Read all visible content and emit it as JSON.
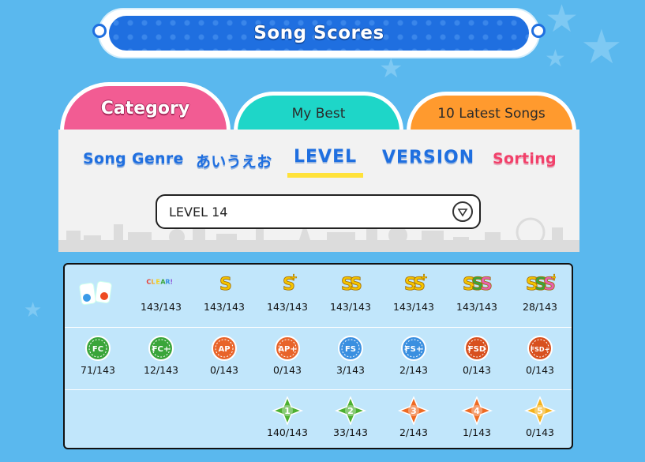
{
  "header": {
    "title": "Song Scores"
  },
  "tabs": [
    {
      "label": "Category",
      "active": true
    },
    {
      "label": "My Best",
      "active": false
    },
    {
      "label": "10 Latest Songs",
      "active": false
    }
  ],
  "filters": {
    "options": [
      "Song Genre",
      "あいうえお",
      "LEVEL",
      "VERSION",
      "Sorting"
    ],
    "selected": "LEVEL"
  },
  "level_select": {
    "value": "LEVEL 14"
  },
  "scores": {
    "rank_row": [
      {
        "icon": "clear-icon",
        "badge": "CLEAR!",
        "count": "143/143"
      },
      {
        "icon": "rank-s-icon",
        "badge": "S",
        "count": "143/143"
      },
      {
        "icon": "rank-s-plus-icon",
        "badge": "S+",
        "count": "143/143"
      },
      {
        "icon": "rank-ss-icon",
        "badge": "SS",
        "count": "143/143"
      },
      {
        "icon": "rank-ss-plus-icon",
        "badge": "SS+",
        "count": "143/143"
      },
      {
        "icon": "rank-sss-icon",
        "badge": "SSS",
        "count": "143/143"
      },
      {
        "icon": "rank-sss-plus-icon",
        "badge": "SSS+",
        "count": "28/143"
      }
    ],
    "combo_row": [
      {
        "icon": "fc-icon",
        "badge": "FC",
        "color": "#3aa53a",
        "count": "71/143"
      },
      {
        "icon": "fc-plus-icon",
        "badge": "FC+",
        "color": "#3aa53a",
        "count": "12/143"
      },
      {
        "icon": "ap-icon",
        "badge": "AP",
        "color": "#e8642a",
        "count": "0/143"
      },
      {
        "icon": "ap-plus-icon",
        "badge": "AP+",
        "color": "#e8642a",
        "count": "0/143"
      },
      {
        "icon": "fs-icon",
        "badge": "FS",
        "color": "#3a8fe0",
        "count": "3/143"
      },
      {
        "icon": "fs-plus-icon",
        "badge": "FS+",
        "color": "#3a8fe0",
        "count": "2/143"
      },
      {
        "icon": "fsd-icon",
        "badge": "FSD",
        "color": "#d8501e",
        "count": "0/143"
      },
      {
        "icon": "fsd-plus-icon",
        "badge": "FSD+",
        "color": "#d8501e",
        "count": "0/143"
      }
    ],
    "star_row": [
      {
        "icon": "star-1-icon",
        "badge": "1",
        "color": "#4cb030",
        "count": "140/143"
      },
      {
        "icon": "star-2-icon",
        "badge": "2",
        "color": "#4cb030",
        "count": "33/143"
      },
      {
        "icon": "star-3-icon",
        "badge": "3",
        "color": "#ee6a22",
        "count": "2/143"
      },
      {
        "icon": "star-4-icon",
        "badge": "4",
        "color": "#ee6a22",
        "count": "1/143"
      },
      {
        "icon": "star-5-icon",
        "badge": "5",
        "color": "#f5b21c",
        "count": "0/143"
      }
    ]
  },
  "colors": {
    "background": "#5ab8ee",
    "title_bar": "#1f6fe0",
    "category_tab": "#f25c93",
    "my_best_tab": "#1ed6c8",
    "latest_tab": "#ff9a2e",
    "selected_underline": "#ffe23a"
  }
}
